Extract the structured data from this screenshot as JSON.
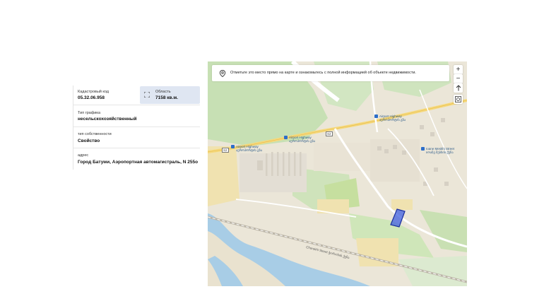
{
  "property": {
    "cadastral_label": "Кадастровый код",
    "cadastral_value": "05.32.06.958",
    "area_label": "Область",
    "area_value": "7158 кв.м.",
    "type_label": "Тип графика",
    "type_value": "несельскохозяйственный",
    "ownership_label": "тип собственности",
    "ownership_value": "Свойство",
    "address_label": "адрес",
    "address_value": "Город Батуми, Аэропортная автомагистраль, N 255о"
  },
  "map": {
    "banner_text": "Отметьте это место прямо на карте и ознакомьтесь с полной информацией об объекте недвижимости.",
    "zoom_in": "+",
    "zoom_out": "−",
    "poi": [
      {
        "line1": "Airport Highway",
        "line2": "აეროპორტის გზა"
      },
      {
        "line1": "Airport Highway",
        "line2": "აეროპორტის გზა"
      },
      {
        "line1": "Airport Highway",
        "line2": "აეროპორტის გზა"
      },
      {
        "line1": "Ioane Meskhi Street",
        "line2": "იოანე მესხის ქუჩა"
      }
    ],
    "road_shields": [
      "S2",
      "S2"
    ],
    "street_label": "Chorokhi Street ჭოროხის ქუჩა",
    "accent_color": "#2a4fd6"
  }
}
